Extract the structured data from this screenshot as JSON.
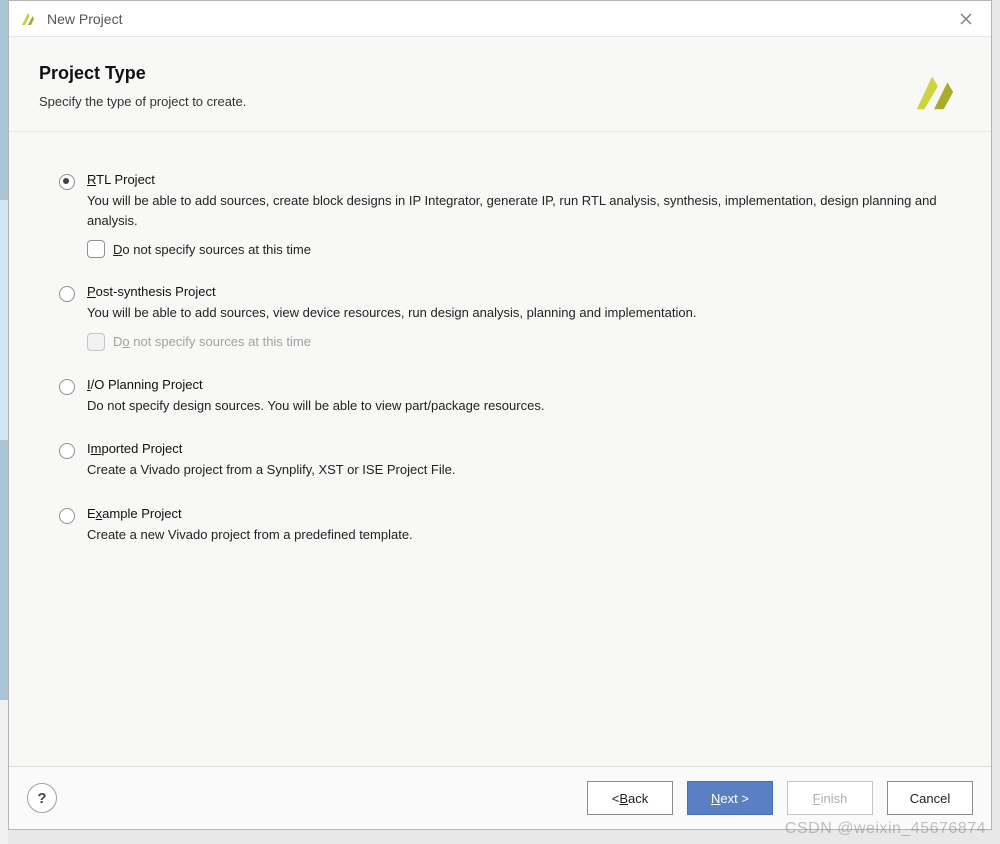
{
  "titlebar": {
    "title": "New Project"
  },
  "header": {
    "title": "Project Type",
    "subtitle": "Specify the type of project to create."
  },
  "options": {
    "rtl": {
      "title_pre": "",
      "title_u": "R",
      "title_post": "TL Project",
      "desc": "You will be able to add sources, create block designs in IP Integrator, generate IP, run RTL analysis, synthesis, implementation, design planning and analysis.",
      "selected": true,
      "check_u": "D",
      "check_post": "o not specify sources at this time",
      "check_disabled": false
    },
    "post": {
      "title_u": "P",
      "title_post": "ost-synthesis Project",
      "desc": "You will be able to add sources, view device resources, run design analysis, planning and implementation.",
      "selected": false,
      "check_pre": "D",
      "check_u": "o",
      "check_post": " not specify sources at this time",
      "check_disabled": true
    },
    "io": {
      "title_u": "I",
      "title_post": "/O Planning Project",
      "desc": "Do not specify design sources. You will be able to view part/package resources.",
      "selected": false
    },
    "imported": {
      "title_pre": "I",
      "title_u": "m",
      "title_post": "ported Project",
      "desc": "Create a Vivado project from a Synplify, XST or ISE Project File.",
      "selected": false
    },
    "example": {
      "title_pre": "E",
      "title_u": "x",
      "title_post": "ample Project",
      "desc": "Create a new Vivado project from a predefined template.",
      "selected": false
    }
  },
  "footer": {
    "help": "?",
    "back_pre": "< ",
    "back_u": "B",
    "back_post": "ack",
    "next_u": "N",
    "next_post": "ext >",
    "finish_u": "F",
    "finish_post": "inish",
    "cancel": "Cancel"
  },
  "watermark": "CSDN @weixin_45676874"
}
